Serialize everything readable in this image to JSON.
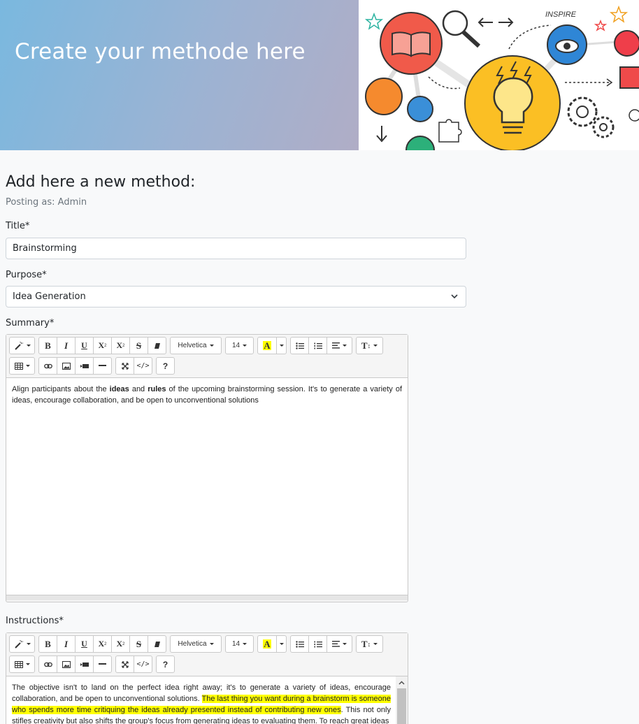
{
  "hero": {
    "title": "Create your methode here",
    "illustration_text": "INSPIRE"
  },
  "form": {
    "heading": "Add here a new method:",
    "posting_as": "Posting as: Admin",
    "title_label": "Title*",
    "title_value": "Brainstorming",
    "purpose_label": "Purpose*",
    "purpose_value": "Idea Generation",
    "summary_label": "Summary*",
    "instructions_label": "Instructions*"
  },
  "toolbar": {
    "font_name": "Helvetica",
    "font_size": "14",
    "bold": "B",
    "italic": "I",
    "underline": "U",
    "superscript": "X",
    "subscript": "X",
    "strikethrough": "S",
    "highlight": "A",
    "help": "?",
    "text_height": "T"
  },
  "summary": {
    "part1": "Align participants about the ",
    "bold1": "ideas",
    "part2": " and ",
    "bold2": "rules",
    "part3": " of the upcoming brainstorming session. It's to generate a variety of ideas, encourage collaboration, and be open to unconventional solutions"
  },
  "instructions": {
    "part1": " The objective isn't to land on the perfect idea right away; it's to generate a variety of ideas, encourage collaboration, and be open to unconventional solutions. ",
    "highlight": "The last thing you want during a brainstorm is someone who spends more time critiquing the ideas already presented instead of contributing new ones",
    "part2": ". This not only stifles creativity but also shifts the group's focus from generating ideas to evaluating them. To reach great ideas"
  },
  "colors": {
    "highlight": "#ffff00",
    "hero_gradient_start": "#7ab8df",
    "hero_gradient_end": "#b0adc6"
  }
}
